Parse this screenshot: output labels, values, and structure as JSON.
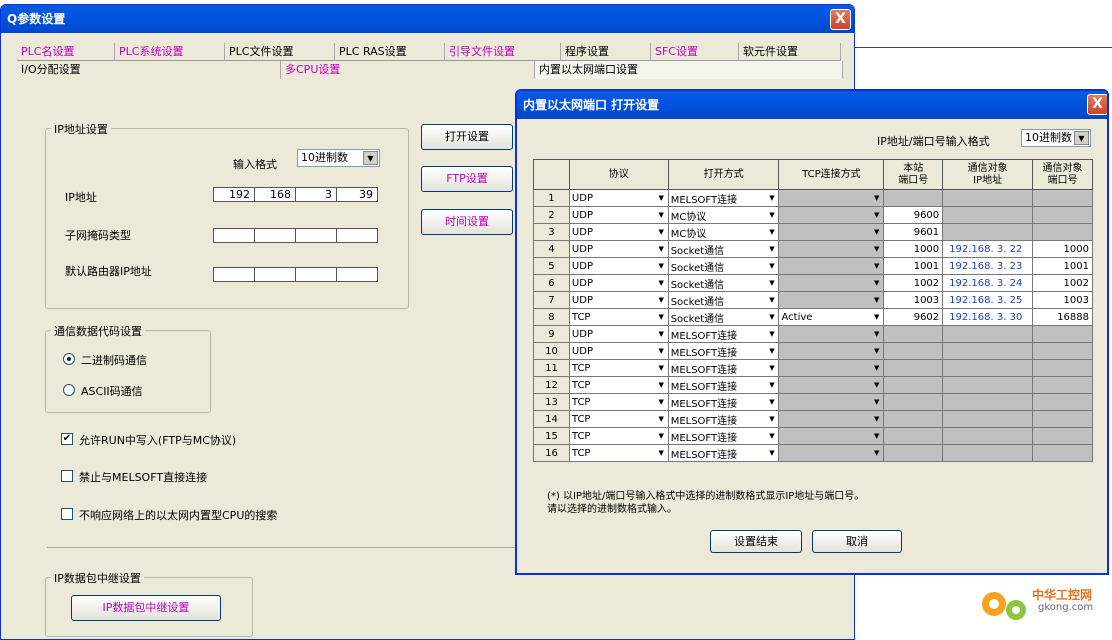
{
  "main_window": {
    "title": "Q参数设置",
    "close_label": "X",
    "tabs_row1": [
      "PLC名设置",
      "PLC系统设置",
      "PLC文件设置",
      "PLC RAS设置",
      "引导文件设置",
      "程序设置",
      "SFC设置",
      "软元件设置"
    ],
    "tabs_row2": [
      "I/O分配设置",
      "多CPU设置",
      "内置以太网端口设置"
    ],
    "ip_group": {
      "title": "IP地址设置",
      "input_format_label": "输入格式",
      "input_format_value": "10进制数",
      "ip_label": "IP地址",
      "ip_octets": [
        "192",
        "168",
        "3",
        "39"
      ],
      "subnet_label": "子网掩码类型",
      "gateway_label": "默认路由器IP地址"
    },
    "buttons": {
      "open": "打开设置",
      "ftp": "FTP设置",
      "time": "时间设置"
    },
    "code_group": {
      "title": "通信数据代码设置",
      "binary": "二进制码通信",
      "ascii": "ASCII码通信"
    },
    "checks": {
      "allow_run_write": "允许RUN中写入(FTP与MC协议)",
      "forbid_melsoft": "禁止与MELSOFT直接连接",
      "no_search": "不响应网络上的以太网内置型CPU的搜索"
    },
    "relay_group": {
      "title": "IP数据包中继设置",
      "button": "IP数据包中继设置"
    }
  },
  "dialog": {
    "title": "内置以太网端口 打开设置",
    "close_label": "X",
    "format_label": "IP地址/端口号输入格式",
    "format_value": "10进制数",
    "headers": {
      "protocol": "协议",
      "open_method": "打开方式",
      "tcp_method": "TCP连接方式",
      "local_port": "本站\n端口号",
      "target_ip": "通信对象\nIP地址",
      "target_port": "通信对象\n端口号"
    },
    "rows": [
      {
        "n": "1",
        "protocol": "UDP",
        "open": "MELSOFT连接",
        "tcp": "",
        "local_port": "",
        "target_ip": "",
        "target_port": ""
      },
      {
        "n": "2",
        "protocol": "UDP",
        "open": "MC协议",
        "tcp": "",
        "local_port": "9600",
        "target_ip": "",
        "target_port": ""
      },
      {
        "n": "3",
        "protocol": "UDP",
        "open": "MC协议",
        "tcp": "",
        "local_port": "9601",
        "target_ip": "",
        "target_port": ""
      },
      {
        "n": "4",
        "protocol": "UDP",
        "open": "Socket通信",
        "tcp": "",
        "local_port": "1000",
        "target_ip": "192.168. 3. 22",
        "target_port": "1000"
      },
      {
        "n": "5",
        "protocol": "UDP",
        "open": "Socket通信",
        "tcp": "",
        "local_port": "1001",
        "target_ip": "192.168. 3. 23",
        "target_port": "1001"
      },
      {
        "n": "6",
        "protocol": "UDP",
        "open": "Socket通信",
        "tcp": "",
        "local_port": "1002",
        "target_ip": "192.168. 3. 24",
        "target_port": "1002"
      },
      {
        "n": "7",
        "protocol": "UDP",
        "open": "Socket通信",
        "tcp": "",
        "local_port": "1003",
        "target_ip": "192.168. 3. 25",
        "target_port": "1003"
      },
      {
        "n": "8",
        "protocol": "TCP",
        "open": "Socket通信",
        "tcp": "Active",
        "local_port": "9602",
        "target_ip": "192.168. 3. 30",
        "target_port": "16888"
      },
      {
        "n": "9",
        "protocol": "UDP",
        "open": "MELSOFT连接",
        "tcp": "",
        "local_port": "",
        "target_ip": "",
        "target_port": ""
      },
      {
        "n": "10",
        "protocol": "UDP",
        "open": "MELSOFT连接",
        "tcp": "",
        "local_port": "",
        "target_ip": "",
        "target_port": ""
      },
      {
        "n": "11",
        "protocol": "TCP",
        "open": "MELSOFT连接",
        "tcp": "",
        "local_port": "",
        "target_ip": "",
        "target_port": ""
      },
      {
        "n": "12",
        "protocol": "TCP",
        "open": "MELSOFT连接",
        "tcp": "",
        "local_port": "",
        "target_ip": "",
        "target_port": ""
      },
      {
        "n": "13",
        "protocol": "TCP",
        "open": "MELSOFT连接",
        "tcp": "",
        "local_port": "",
        "target_ip": "",
        "target_port": ""
      },
      {
        "n": "14",
        "protocol": "TCP",
        "open": "MELSOFT连接",
        "tcp": "",
        "local_port": "",
        "target_ip": "",
        "target_port": ""
      },
      {
        "n": "15",
        "protocol": "TCP",
        "open": "MELSOFT连接",
        "tcp": "",
        "local_port": "",
        "target_ip": "",
        "target_port": ""
      },
      {
        "n": "16",
        "protocol": "TCP",
        "open": "MELSOFT连接",
        "tcp": "",
        "local_port": "",
        "target_ip": "",
        "target_port": ""
      }
    ],
    "note_line1": "(*) 以IP地址/端口号输入格式中选择的进制数格式显示IP地址与端口号。",
    "note_line2": "请以选择的进制数格式输入。",
    "ok_button": "设置结束",
    "cancel_button": "取消"
  },
  "watermark": {
    "line1": "中华工控网",
    "line2": "gkong.com"
  }
}
